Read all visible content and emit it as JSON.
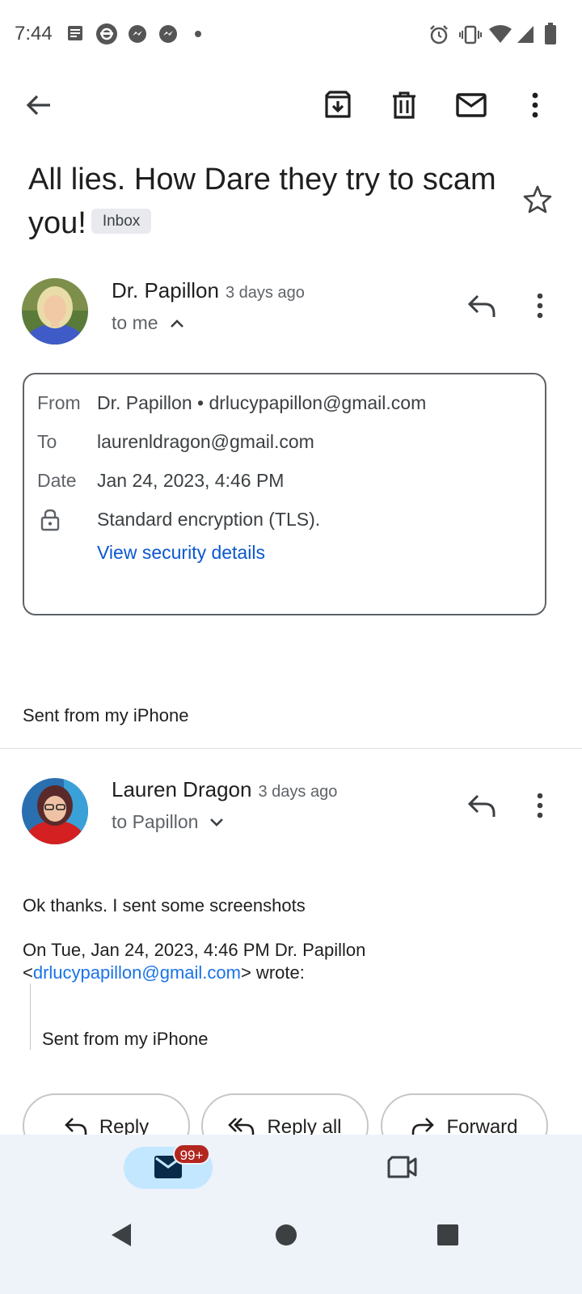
{
  "status_bar": {
    "time": "7:44",
    "left_icons": [
      "message-icon",
      "bluetooth-sync-icon",
      "messenger-icon",
      "messenger-icon",
      "dot-icon"
    ],
    "right_icons": [
      "alarm-icon",
      "vibrate-icon",
      "wifi-icon",
      "signal-icon",
      "battery-icon"
    ]
  },
  "toolbar": {
    "icons": [
      "back-arrow-icon",
      "archive-icon",
      "delete-icon",
      "mark-unread-icon",
      "more-vert-icon"
    ]
  },
  "subject": {
    "text": "All lies. How Dare they try to scam you!",
    "label": "Inbox"
  },
  "message1": {
    "sender": "Dr. Papillon",
    "time": "3 days ago",
    "to_line": "to me",
    "details": {
      "from_label": "From",
      "from_value": "Dr. Papillon • drlucypapillon@gmail.com",
      "to_label": "To",
      "to_value": "laurenldragon@gmail.com",
      "date_label": "Date",
      "date_value": "Jan 24, 2023, 4:46 PM",
      "security_value": "Standard encryption (TLS).",
      "security_link": "View security details"
    },
    "body": "Sent from my iPhone"
  },
  "message2": {
    "sender": "Lauren Dragon",
    "time": "3 days ago",
    "to_line": "to Papillon",
    "body": "Ok thanks. I sent some screenshots",
    "quote_header_1": "On Tue, Jan 24, 2023, 4:46 PM Dr. Papillon",
    "quote_open": "<",
    "quote_email": "drlucypapillon@gmail.com",
    "quote_close": "> wrote:",
    "quoted_body": "Sent from my iPhone"
  },
  "actions": {
    "reply": "Reply",
    "reply_all": "Reply all",
    "forward": "Forward"
  },
  "bottom_nav": {
    "mail_badge": "99+"
  },
  "colors": {
    "accent_link": "#0b57d0",
    "badge_red": "#b3261e",
    "nav_pill": "#c2e7ff",
    "nav_bg": "#eef2f9"
  }
}
